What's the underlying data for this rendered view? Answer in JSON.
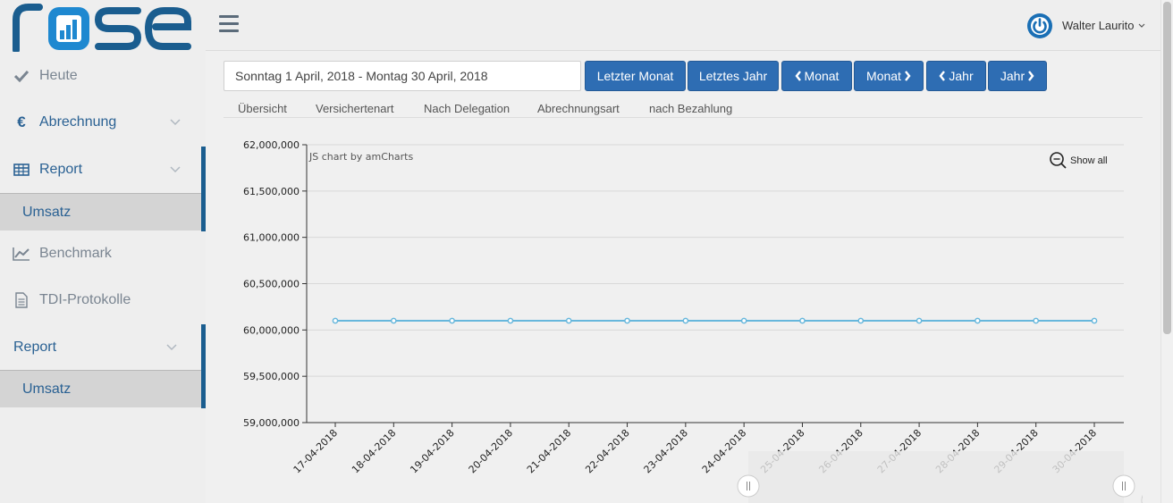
{
  "app": {
    "logo_text": "rose"
  },
  "sidebar": {
    "items": [
      {
        "label": "Heute"
      },
      {
        "label": "Abrechnung"
      },
      {
        "label": "Report"
      },
      {
        "label": "Umsatz"
      },
      {
        "label": "Benchmark"
      },
      {
        "label": "TDI-Protokolle"
      },
      {
        "label": "Report"
      },
      {
        "label": "Umsatz"
      }
    ]
  },
  "header": {
    "user_name": "Walter Laurito"
  },
  "filters": {
    "date_range": "Sonntag 1 April, 2018 - Montag 30 April, 2018",
    "buttons": {
      "last_month": "Letzter Monat",
      "last_year": "Letztes Jahr",
      "prev_month": "Monat",
      "next_month": "Monat",
      "prev_year": "Jahr",
      "next_year": "Jahr"
    }
  },
  "tabs": [
    "Übersicht",
    "Versichertenart",
    "Nach Delegation",
    "Abrechnungsart",
    "nach Bezahlung"
  ],
  "chart_controls": {
    "credit": "JS chart by amCharts",
    "show_all": "Show all"
  },
  "colors": {
    "accent": "#2e6db3",
    "sidebar_text": "#2a6193",
    "series_line": "#67b7dc"
  },
  "chart_data": {
    "type": "line",
    "x": [
      "17-04-2018",
      "18-04-2018",
      "19-04-2018",
      "20-04-2018",
      "21-04-2018",
      "22-04-2018",
      "23-04-2018",
      "24-04-2018",
      "25-04-2018",
      "26-04-2018",
      "27-04-2018",
      "28-04-2018",
      "29-04-2018",
      "30-04-2018"
    ],
    "series": [
      {
        "values": [
          60100000,
          60100000,
          60100000,
          60100000,
          60100000,
          60100000,
          60100000,
          60100000,
          60100000,
          60100000,
          60100000,
          60100000,
          60100000,
          60100000
        ]
      }
    ],
    "ylim": [
      59000000,
      62000000
    ],
    "yticks": [
      62000000,
      61500000,
      61000000,
      60500000,
      60000000,
      59500000,
      59000000
    ],
    "ytick_labels": [
      "62,000,000",
      "61,500,000",
      "61,000,000",
      "60,500,000",
      "60,000,000",
      "59,500,000",
      "59,000,000"
    ],
    "grid": true,
    "title": "",
    "xlabel": "",
    "ylabel": ""
  }
}
